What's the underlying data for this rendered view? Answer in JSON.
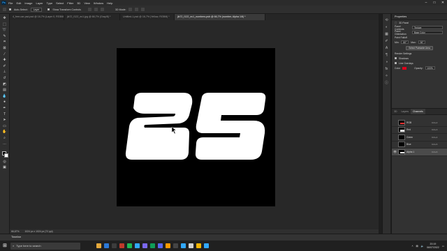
{
  "menu": [
    "File",
    "Edit",
    "Image",
    "Layer",
    "Type",
    "Select",
    "Filter",
    "3D",
    "View",
    "Window",
    "Help"
  ],
  "app_badge": "Ps",
  "window_controls": [
    "–",
    "□",
    "✕"
  ],
  "options": {
    "auto_select_label": "Auto-Select:",
    "auto_select_value": "Layer",
    "transform_label": "Show Transform Controls",
    "mode_label": "3D Mode:"
  },
  "tabs": [
    {
      "label": "4_free-car-psd.psd @ 16,7% (Layer 0, RGB/8) *"
    },
    {
      "label": "jlk72_f122_ec1.jpg @ 66,7% (Gray/8) *"
    },
    {
      "label": "Untitled-1.psd @ 16,7% (Yellow, RGB/8) *"
    },
    {
      "label": "jlk72_f122_ec1_numbers.psb @ 66,7% (number, Alpha 1/8) *",
      "active": true
    }
  ],
  "status": {
    "zoom": "66,67%",
    "doc": "1024 px x 1024 px (72 ppi)"
  },
  "timeline_label": "Timeline",
  "canvas_text": "25",
  "properties": {
    "title": "Properties",
    "subtitle": "3D Panel",
    "rows": [
      {
        "label": "Panel Contents",
        "value": "Texture"
      },
      {
        "label": "Panel Orientation",
        "value": "Base Color"
      }
    ],
    "paint_label": "Paint Falloff",
    "min_label": "Min:",
    "min_value": "80°",
    "max_label": "Max:",
    "max_value": "90°",
    "select_button": "Select Paintable Area",
    "render_label": "Render Settings",
    "shadows_label": "Shadows",
    "lines_label": "Line Overlays",
    "color_label": "Color",
    "opacity_label": "Opacity:",
    "opacity_value": "100%",
    "swatch_color": "#e0001b"
  },
  "channels": {
    "tabs": [
      "3D",
      "Layers",
      "Channels"
    ],
    "active_tab": "Channels",
    "rows": [
      {
        "name": "RGB",
        "shortcut": "Ctrl+2"
      },
      {
        "name": "Red",
        "shortcut": "Ctrl+3"
      },
      {
        "name": "Green",
        "shortcut": "Ctrl+4"
      },
      {
        "name": "Blue",
        "shortcut": "Ctrl+5"
      },
      {
        "name": "Alpha 1",
        "shortcut": "Ctrl+6",
        "selected": true
      }
    ]
  },
  "taskbar": {
    "search_placeholder": "Type here to search",
    "time": "20:19",
    "date": "06/07/2022",
    "app_colors": [
      "#e6a93b",
      "#2b78d6",
      "#3c3c3c",
      "#c0392b",
      "#1db954",
      "#31a8ff",
      "#7b68ee",
      "#0f9d58",
      "#5865f2",
      "#ff9a00",
      "#444444",
      "#31a8ff",
      "#d0d0d0",
      "#f4b400",
      "#31a8ff"
    ]
  }
}
